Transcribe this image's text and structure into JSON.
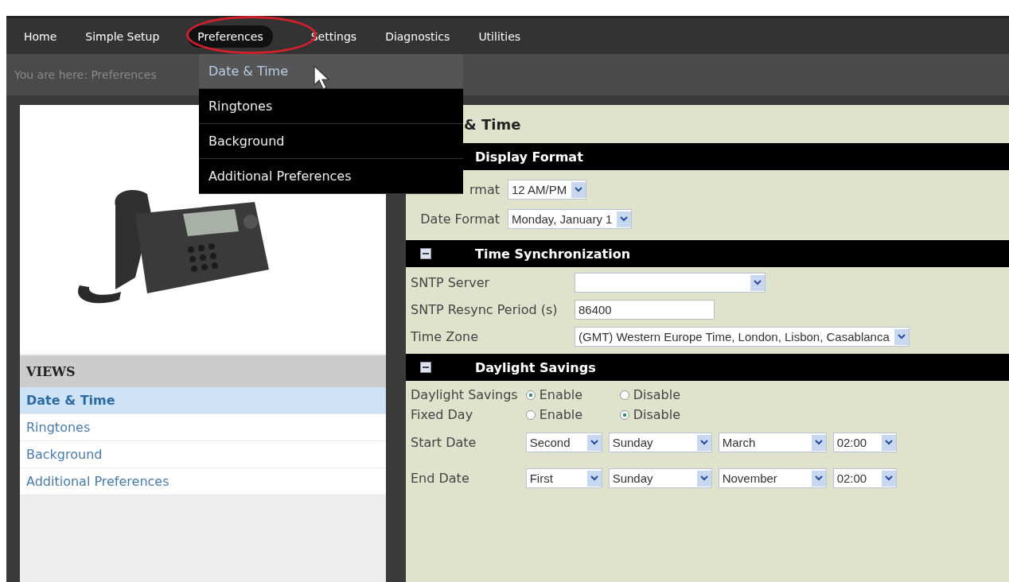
{
  "nav": [
    {
      "label": "Home",
      "selected": false
    },
    {
      "label": "Simple Setup",
      "selected": false
    },
    {
      "label": "Preferences",
      "selected": true
    },
    {
      "label": "Settings",
      "selected": false
    },
    {
      "label": "Diagnostics",
      "selected": false
    },
    {
      "label": "Utilities",
      "selected": false
    }
  ],
  "dropdown": [
    {
      "label": "Date & Time",
      "selected": true
    },
    {
      "label": "Ringtones",
      "selected": false
    },
    {
      "label": "Background",
      "selected": false
    },
    {
      "label": "Additional Preferences",
      "selected": false
    }
  ],
  "breadcrumb": "You are here: Preferences",
  "views": {
    "title": "VIEWS",
    "items": [
      {
        "label": "Date & Time",
        "selected": true
      },
      {
        "label": "Ringtones",
        "selected": false
      },
      {
        "label": "Background",
        "selected": false
      },
      {
        "label": "Additional Preferences",
        "selected": false
      }
    ]
  },
  "page_title": "& Time",
  "sections": [
    {
      "title": "Display Format",
      "rows": [
        {
          "kind": "select",
          "label": "rmat",
          "value": "12 AM/PM"
        },
        {
          "kind": "select",
          "label": "Date Format",
          "value": "Monday, January 1"
        }
      ]
    },
    {
      "title": "Time Synchronization",
      "rows": [
        {
          "kind": "select",
          "label": "SNTP Server"
        },
        {
          "kind": "input",
          "label": "SNTP Resync Period (s)",
          "value": "86400"
        },
        {
          "kind": "select",
          "label": "Time Zone",
          "value": "(GMT) Western Europe Time, London, Lisbon, Casablanca"
        }
      ]
    },
    {
      "title": "Daylight Savings",
      "rows": [
        {
          "kind": "radio",
          "label": "Daylight Savings",
          "options": [
            {
              "label": "Enable",
              "selected": true
            },
            {
              "label": "Disable",
              "selected": false
            }
          ]
        },
        {
          "kind": "radio",
          "label": "Fixed Day",
          "options": [
            {
              "label": "Enable",
              "selected": false
            },
            {
              "label": "Disable",
              "selected": true
            }
          ]
        },
        {
          "kind": "selects",
          "label": "Start Date",
          "values": [
            "Second",
            "Sunday",
            "March",
            "02:00"
          ]
        },
        {
          "kind": "selects",
          "label": "End Date",
          "values": [
            "First",
            "Sunday",
            "November",
            "02:00"
          ]
        }
      ]
    }
  ]
}
